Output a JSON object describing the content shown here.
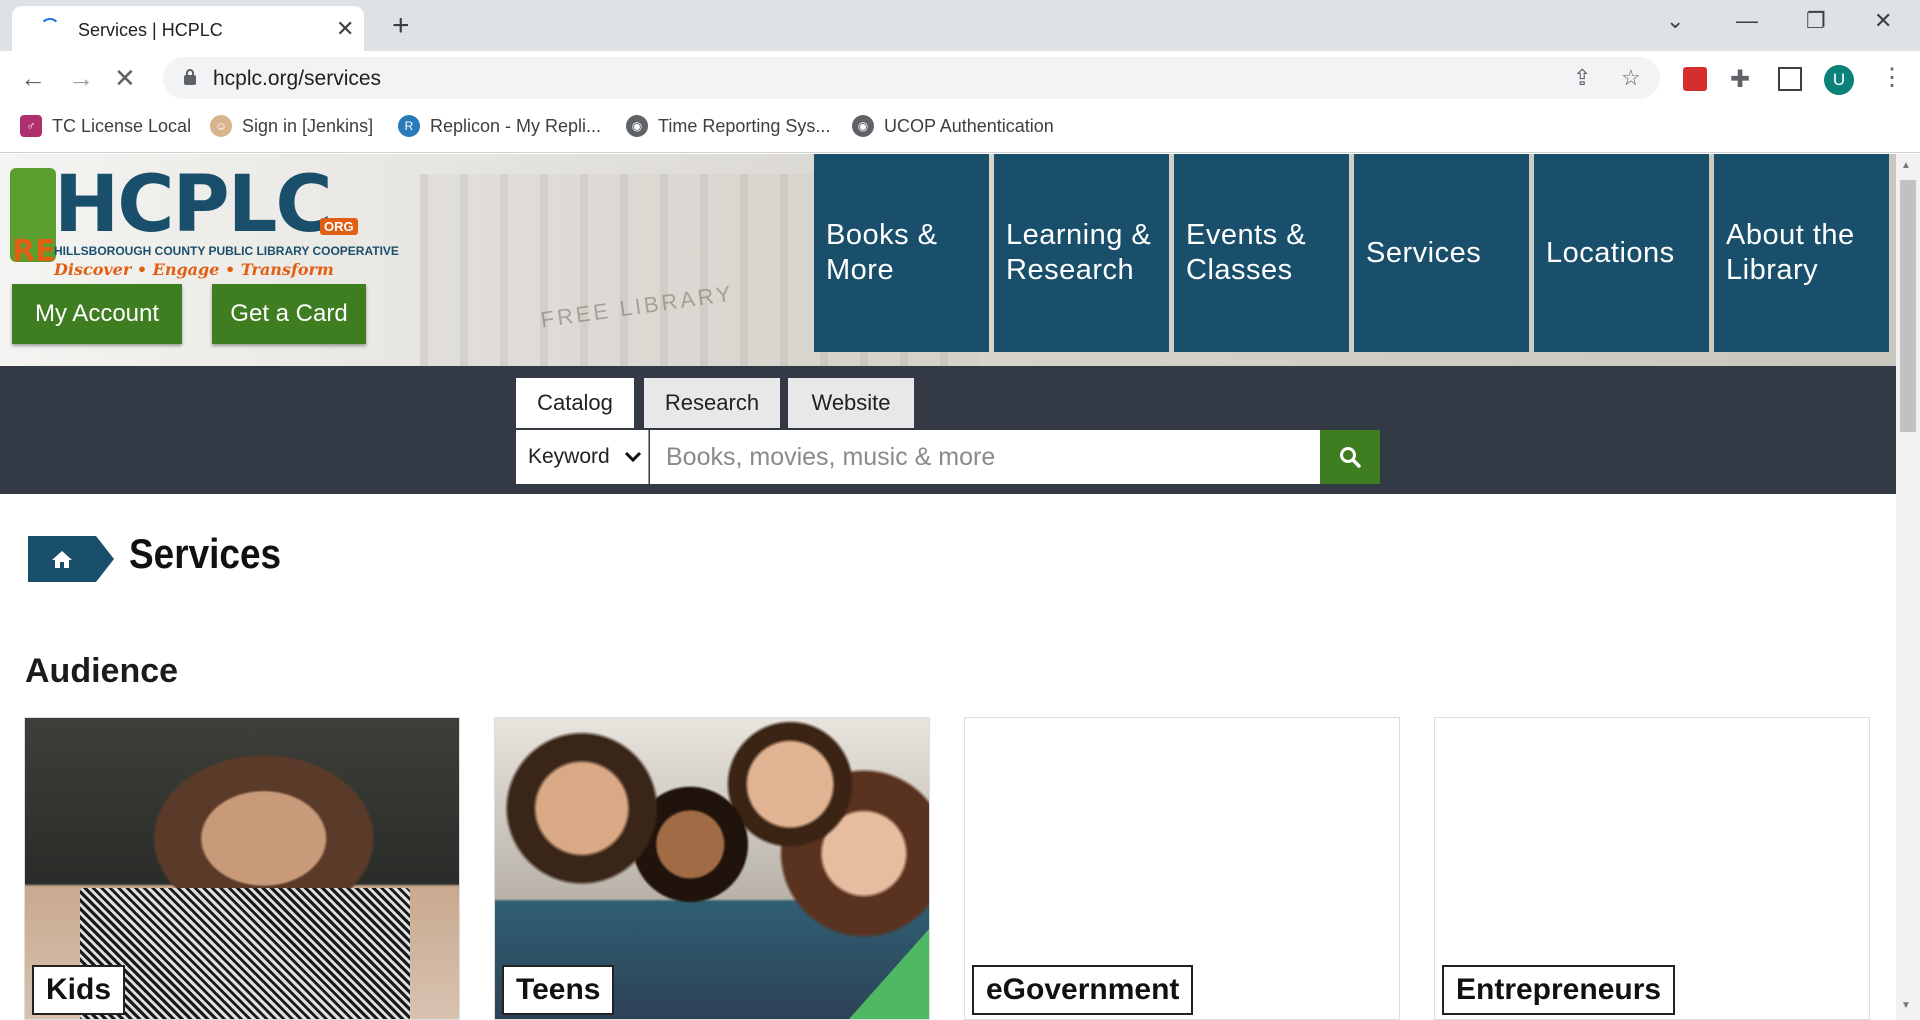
{
  "browser": {
    "tab_title": "Services | HCPLC",
    "url": "hcplc.org/services",
    "profile_initial": "U",
    "bookmarks": [
      {
        "label": "TC License Local"
      },
      {
        "label": "Sign in [Jenkins]"
      },
      {
        "label": "Replicon - My Repli..."
      },
      {
        "label": "Time Reporting Sys..."
      },
      {
        "label": "UCOP Authentication"
      }
    ]
  },
  "header": {
    "logo": {
      "name": "HCPLC",
      "org": "ORG",
      "subtitle": "HILLSBOROUGH COUNTY PUBLIC LIBRARY COOPERATIVE",
      "tagline": "Discover • Engage • Transform",
      "re": "RE"
    },
    "building_text": "FREE LIBRARY",
    "buttons": {
      "my_account": "My Account",
      "get_card": "Get a Card"
    },
    "nav": [
      {
        "label": "Books & More"
      },
      {
        "label": "Learning & Research"
      },
      {
        "label": "Events & Classes"
      },
      {
        "label": "Services"
      },
      {
        "label": "Locations"
      },
      {
        "label": "About the Library"
      }
    ]
  },
  "search": {
    "tabs": [
      {
        "label": "Catalog",
        "active": true
      },
      {
        "label": "Research",
        "active": false
      },
      {
        "label": "Website",
        "active": false
      }
    ],
    "scope_selected": "Keyword",
    "placeholder": "Books, movies, music & more"
  },
  "breadcrumb": {
    "title": "Services"
  },
  "audience": {
    "heading": "Audience",
    "cards": [
      {
        "label": "Kids"
      },
      {
        "label": "Teens"
      },
      {
        "label": "eGovernment"
      },
      {
        "label": "Entrepreneurs"
      }
    ]
  },
  "colors": {
    "nav_blue": "#1a4f6b",
    "brand_green": "#3f7d21",
    "accent_orange": "#e15f12",
    "search_band": "#333a45"
  }
}
